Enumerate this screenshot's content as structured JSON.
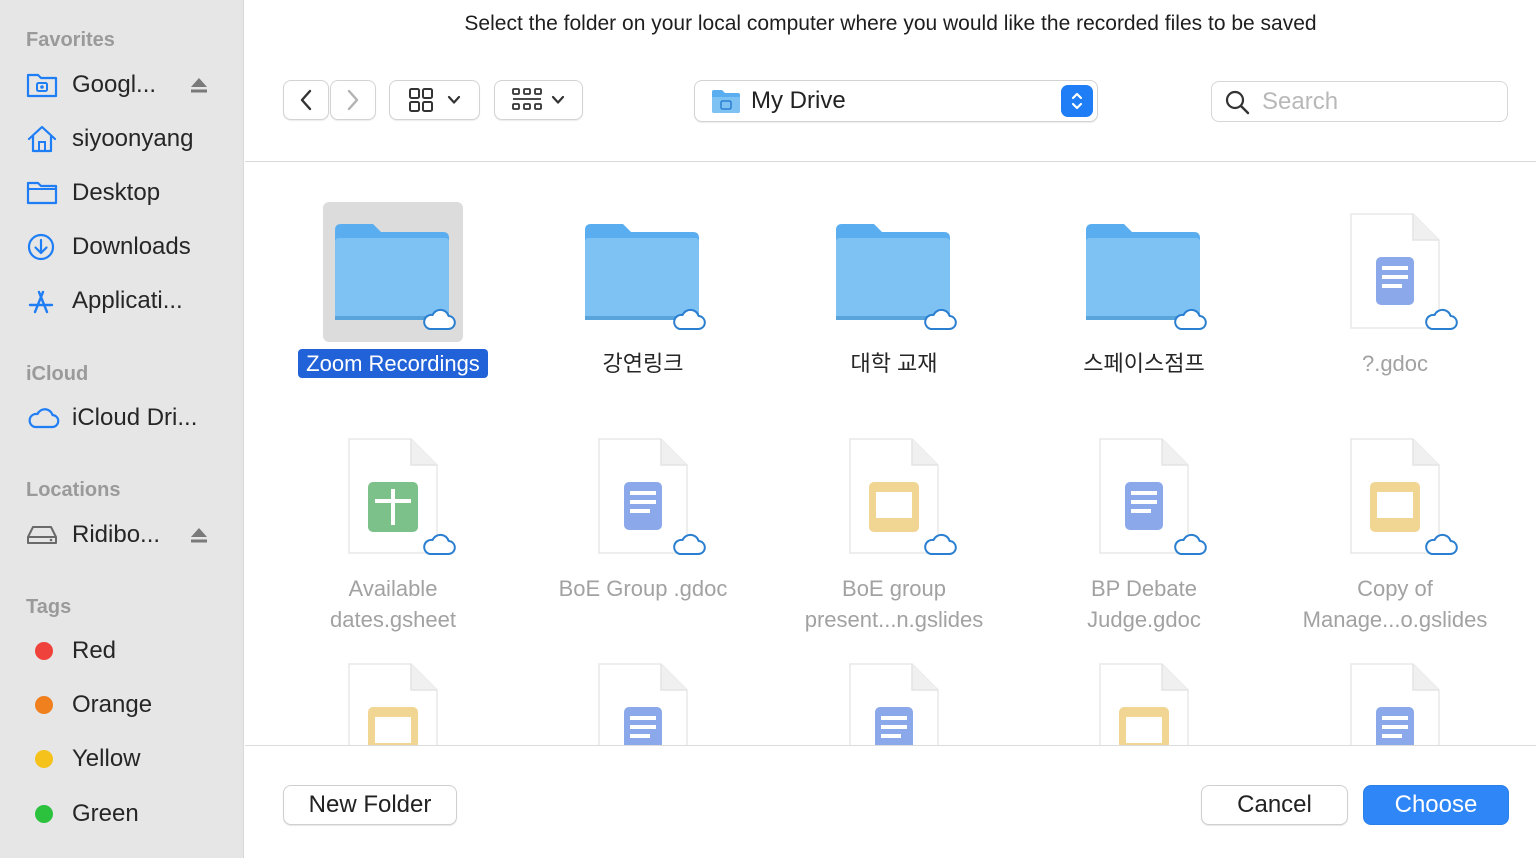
{
  "prompt": "Select the folder on your local computer where you would like the recorded files to be saved",
  "sidebar": {
    "sections": {
      "favorites": "Favorites",
      "icloud": "iCloud",
      "locations": "Locations",
      "tags": "Tags"
    },
    "favorites": [
      {
        "label": "Googl...",
        "icon": "google-drive-icon"
      },
      {
        "label": "siyoonyang",
        "icon": "home-icon"
      },
      {
        "label": "Desktop",
        "icon": "desktop-folder-icon"
      },
      {
        "label": "Downloads",
        "icon": "downloads-icon"
      },
      {
        "label": "Applicati...",
        "icon": "applications-icon"
      }
    ],
    "icloud": [
      {
        "label": "iCloud Dri...",
        "icon": "icloud-icon"
      }
    ],
    "locations": [
      {
        "label": "Ridibo...",
        "icon": "drive-icon"
      }
    ],
    "tags": [
      {
        "label": "Red",
        "color": "#f0423c"
      },
      {
        "label": "Orange",
        "color": "#f0801e"
      },
      {
        "label": "Yellow",
        "color": "#f5c21b"
      },
      {
        "label": "Green",
        "color": "#2cc23e"
      }
    ]
  },
  "toolbar": {
    "location": "My Drive",
    "search_placeholder": "Search"
  },
  "items": [
    {
      "name": "Zoom Recordings",
      "kind": "folder",
      "selected": true
    },
    {
      "name": "강연링크",
      "kind": "folder"
    },
    {
      "name": "대학 교재",
      "kind": "folder"
    },
    {
      "name": "스페이스점프",
      "kind": "folder"
    },
    {
      "name": "?.gdoc",
      "kind": "gdoc",
      "dim": true
    },
    {
      "name": "Available dates.gsheet",
      "line1": "Available",
      "line2": "dates.gsheet",
      "kind": "gsheet",
      "dim": true
    },
    {
      "name": "BoE Group .gdoc",
      "line1": "BoE Group .gdoc",
      "kind": "gdoc",
      "dim": true
    },
    {
      "name": "BoE group present...n.gslides",
      "line1": "BoE group",
      "line2": "present...n.gslides",
      "kind": "gslides",
      "dim": true
    },
    {
      "name": "BP Debate Judge.gdoc",
      "line1": "BP Debate",
      "line2": "Judge.gdoc",
      "kind": "gdoc",
      "dim": true
    },
    {
      "name": "Copy of Manage...o.gslides",
      "line1": "Copy of",
      "line2": "Manage...o.gslides",
      "kind": "gslides",
      "dim": true
    },
    {
      "kind": "gslides",
      "dim": true
    },
    {
      "kind": "gdoc",
      "dim": true
    },
    {
      "kind": "gdoc",
      "dim": true
    },
    {
      "kind": "gslides",
      "dim": true
    },
    {
      "kind": "gdoc",
      "dim": true
    }
  ],
  "buttons": {
    "new_folder": "New Folder",
    "cancel": "Cancel",
    "choose": "Choose"
  },
  "colors": {
    "accent": "#2e86f7",
    "selection": "#2162d8",
    "folder": "#7ec2f3",
    "gdoc": "#8aa8ea",
    "gsheet": "#7cc08a",
    "gslides": "#f1d592"
  }
}
